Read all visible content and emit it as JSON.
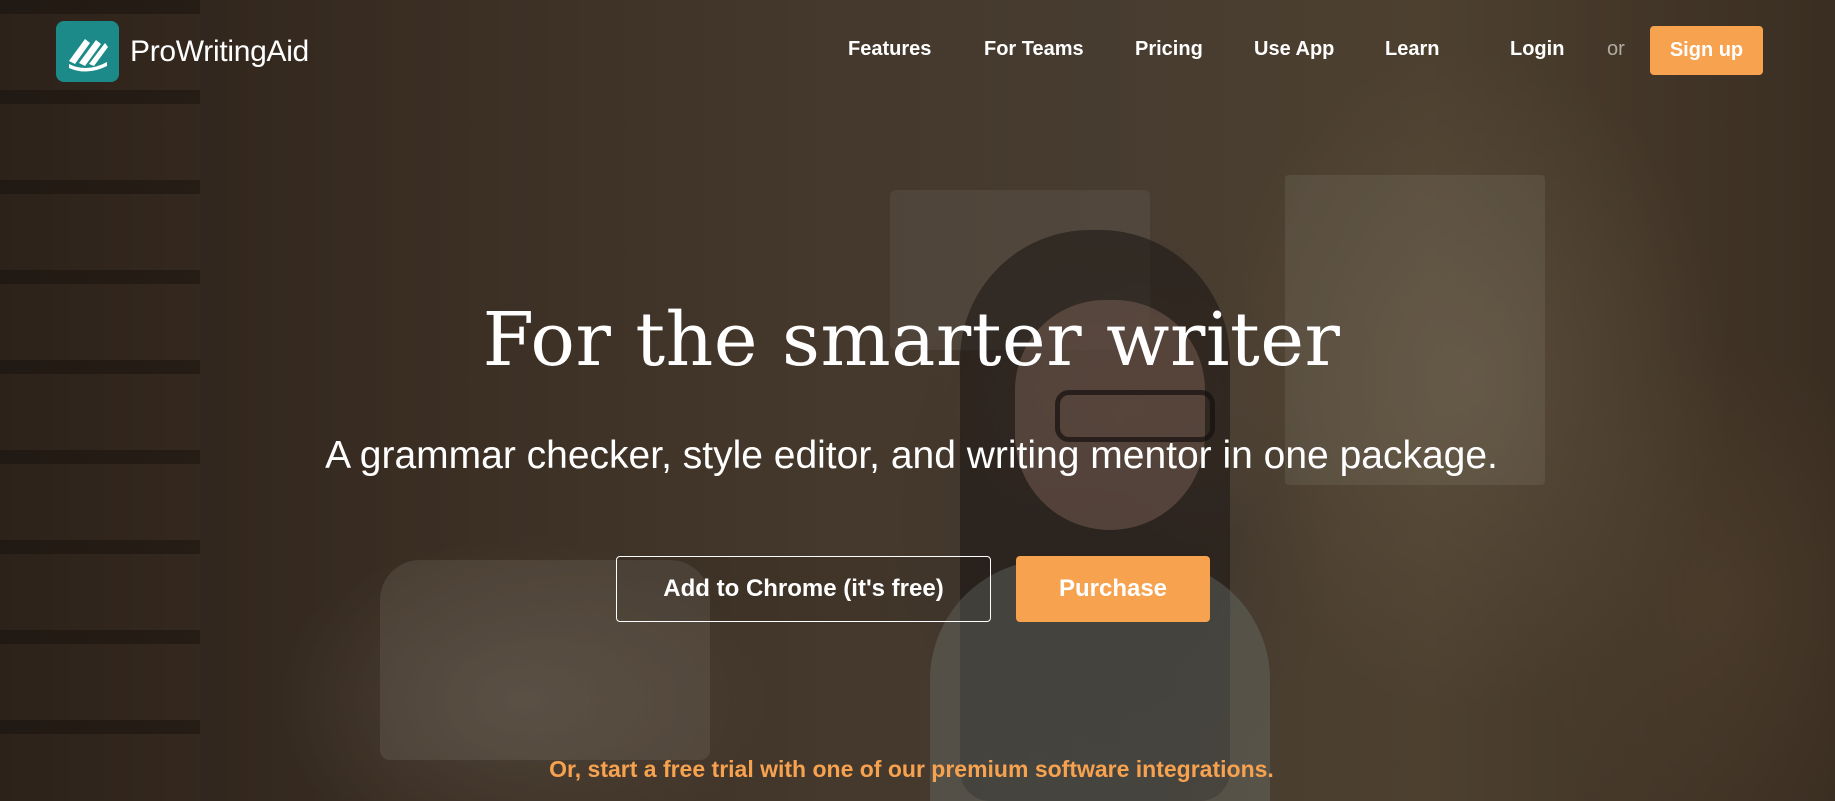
{
  "brand": {
    "name": "ProWritingAid",
    "logo_color": "#1b8a88"
  },
  "nav": {
    "items": [
      {
        "label": "Features"
      },
      {
        "label": "For Teams"
      },
      {
        "label": "Pricing"
      },
      {
        "label": "Use App"
      },
      {
        "label": "Learn"
      }
    ],
    "login_label": "Login",
    "or_label": "or",
    "signup_label": "Sign up"
  },
  "hero": {
    "headline": "For the smarter writer",
    "subhead": "A grammar checker, style editor, and writing mentor in one package.",
    "chrome_button_label": "Add to Chrome (it's free)",
    "purchase_button_label": "Purchase",
    "trial_link_text": "Or, start a free trial with one of our premium software integrations."
  },
  "colors": {
    "accent": "#f7a24f",
    "text": "#ffffff",
    "muted": "#b3aba3"
  }
}
